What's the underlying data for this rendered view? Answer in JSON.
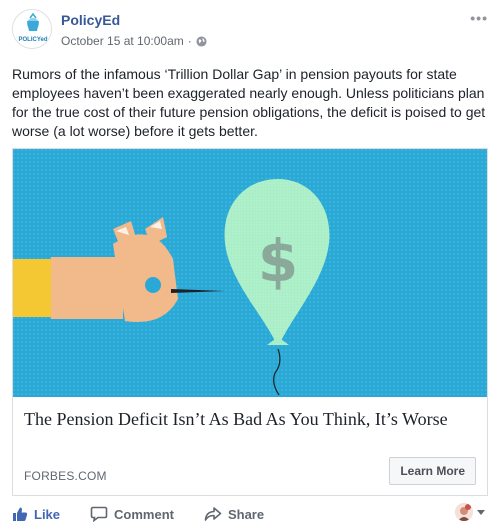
{
  "post": {
    "page_name": "PolicyEd",
    "logo_text": "POLICYed",
    "timestamp": "October 15 at 10:00am",
    "separator": "·",
    "privacy_icon": "globe-icon",
    "more_icon": "ellipsis-icon",
    "more_label": "•••",
    "text": "Rumors of the infamous ‘Trillion Dollar Gap’ in pension payouts for state employees haven’t been exaggerated nearly enough. Unless politicians plan for the true cost of their future pension obligations, the deficit is poised to get worse (a lot worse) before it gets better."
  },
  "link_card": {
    "image_symbol": "$",
    "title": "The Pension Deficit Isn’t As Bad As You Think, It’s Worse",
    "domain": "FORBES.COM",
    "cta_label": "Learn More"
  },
  "actions": {
    "like_label": "Like",
    "comment_label": "Comment",
    "share_label": "Share"
  },
  "colors": {
    "accent": "#4267b2",
    "page_name": "#385898",
    "image_bg": "#2aa9d6",
    "balloon": "#a9eec6",
    "arm": "#f2b98b",
    "cuff": "#f3c832"
  }
}
